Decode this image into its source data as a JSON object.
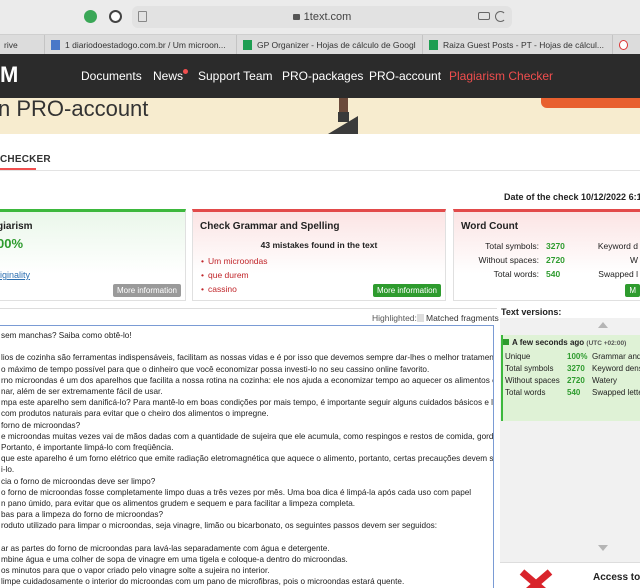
{
  "browser": {
    "url": "1text.com",
    "tabs": [
      {
        "label": "rive"
      },
      {
        "label": "1 diariodoestadogo.com.br / Um microon..."
      },
      {
        "label": "GP Organizer - Hojas de cálculo de Google"
      },
      {
        "label": "Raiza Guest Posts - PT - Hojas de cálcul..."
      }
    ]
  },
  "nav": {
    "logo": "M",
    "items": [
      "Documents",
      "News",
      "Support Team",
      "PRO-packages",
      "PRO-account",
      "Plagiarism Checker"
    ]
  },
  "banner": {
    "title": "n PRO-account"
  },
  "checker": {
    "label": "CHECKER",
    "date_check": "Date of the check 10/12/2022 6:1"
  },
  "cards": {
    "uniqueness": {
      "title": "giarism",
      "value": "00%",
      "link": "riginality",
      "more": "More information"
    },
    "grammar": {
      "title": "Check Grammar and Spelling",
      "mistakes": "43 mistakes found in the text",
      "items": [
        "Um microondas",
        "que durem",
        "cassino"
      ],
      "more": "More information"
    },
    "wordcount": {
      "title": "Word Count",
      "rows": [
        {
          "label": "Total symbols:",
          "value": "3270",
          "extra": "Keyword d"
        },
        {
          "label": "Without spaces:",
          "value": "2720",
          "extra": "W"
        },
        {
          "label": "Total words:",
          "value": "540",
          "extra": "Swapped l"
        }
      ],
      "more": "M"
    }
  },
  "textarea": {
    "highlighted_label": "Highlighted:",
    "matched_label": "Matched fragments",
    "lines": [
      "sem manchas? Saiba como obtê-lo!",
      "",
      "lios de cozinha são ferramentas indispensáveis, facilitam as nossas vidas e é por isso que devemos sempre dar-lhes o melhor tratamento",
      "o máximo de tempo possível para que o dinheiro que você economizar possa investi-lo no seu cassino online favorito.",
      "rno microondas é um dos aparelhos que facilita a nossa rotina na cozinha: ele nos ajuda a economizar tempo ao aquecer os alimentos e até",
      "nar, além de ser extremamente fácil de usar.",
      "mpa este aparelho sem danificá-lo? Para mantê-lo em boas condições por mais tempo, é importante seguir alguns cuidados básicos e limpá-",
      "com produtos naturais para evitar que o cheiro dos alimentos o impregne.",
      "forno de microondas?",
      "e microondas muitas vezes vai de mãos dadas com a quantidade de sujeira que ele acumula, como respingos e restos de comida, gordura",
      "Portanto, é importante limpá-lo com freqüência.",
      "que este aparelho é um forno elétrico que emite radiação eletromagnética que aquece o alimento, portanto, certas precauções devem ser",
      "i-lo.",
      "cia o forno de microondas deve ser limpo?",
      "o forno de microondas fosse completamente limpo duas a três vezes por mês. Uma boa dica é limpá-la após cada uso com papel",
      "n pano úmido, para evitar que os alimentos grudem e sequem e para facilitar a limpeza completa.",
      "bas para a limpeza do forno de microondas?",
      "roduto utilizado para limpar o microondas, seja vinagre, limão ou bicarbonato, os seguintes passos devem ser seguidos:",
      "",
      "ar as partes do forno de microondas para lavá-las separadamente com água e detergente.",
      "mbine água e uma colher de sopa de vinagre em uma tigela e coloque-a dentro do microondas.",
      "os minutos para que o vapor criado pelo vinagre solte a sujeira no interior.",
      "limpe cuidadosamente o interior do microondas com um pano de microfibras, pois o microondas estará quente."
    ]
  },
  "versions": {
    "title": "Text versions:",
    "head": "A few seconds ago",
    "head_tz": "(UTC +02:00)",
    "rows": [
      {
        "label": "Unique",
        "value": "100%",
        "extra": "Grammar and S"
      },
      {
        "label": "Total symbols",
        "value": "3270",
        "extra": "Keyword densit"
      },
      {
        "label": "Without spaces",
        "value": "2720",
        "extra": "Watery"
      },
      {
        "label": "Total words",
        "value": "540",
        "extra": "Swapped letter"
      }
    ],
    "access": "Access to"
  },
  "colors": {
    "nav_bg": "#2b2b2b",
    "accent_red": "#f04e4e",
    "green": "#2e9b2e",
    "banner": "#f7eccf"
  }
}
